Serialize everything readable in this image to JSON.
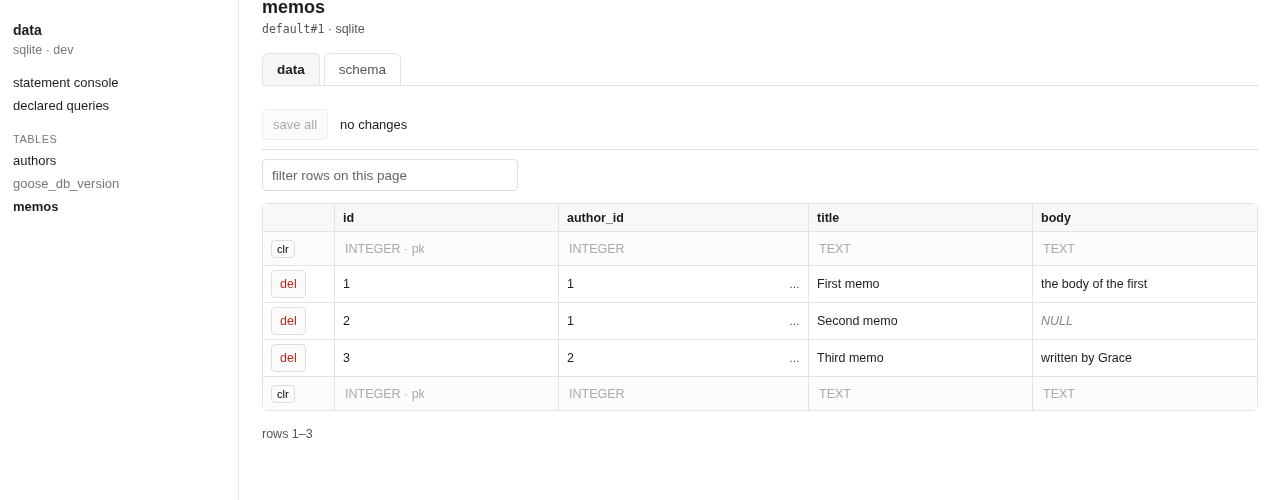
{
  "sidebar": {
    "title": "data",
    "subtitle": "sqlite · dev",
    "links": [
      {
        "label": "statement console"
      },
      {
        "label": "declared queries"
      }
    ],
    "section": "TABLES",
    "tables": [
      {
        "label": "authors",
        "selected": false,
        "dimmed": false
      },
      {
        "label": "goose_db_version",
        "selected": false,
        "dimmed": true
      },
      {
        "label": "memos",
        "selected": true,
        "dimmed": false
      }
    ]
  },
  "header": {
    "title": "memos",
    "connection": "default#1",
    "subtitle": " · sqlite"
  },
  "tabs": [
    {
      "label": "data",
      "selected": true
    },
    {
      "label": "schema",
      "selected": false
    }
  ],
  "toolbar": {
    "save_button": "save all",
    "save_disabled": true,
    "status": "no changes"
  },
  "filter": {
    "placeholder": "filter rows on this page"
  },
  "table": {
    "columns": [
      "id",
      "author_id",
      "title",
      "body"
    ],
    "top_filter": {
      "clear_button": "clr",
      "type_hints": [
        "INTEGER · pk",
        "INTEGER",
        "TEXT",
        "TEXT"
      ]
    },
    "rows": [
      {
        "delete_button": "del",
        "fk_button": "…",
        "cells": [
          {
            "value": "1",
            "null": false
          },
          {
            "value": "1",
            "null": false
          },
          {
            "value": "First memo",
            "null": false
          },
          {
            "value": "the body of the first",
            "null": false
          }
        ]
      },
      {
        "delete_button": "del",
        "fk_button": "…",
        "cells": [
          {
            "value": "2",
            "null": false
          },
          {
            "value": "1",
            "null": false
          },
          {
            "value": "Second memo",
            "null": false
          },
          {
            "value": "NULL",
            "null": true
          }
        ]
      },
      {
        "delete_button": "del",
        "fk_button": "…",
        "cells": [
          {
            "value": "3",
            "null": false
          },
          {
            "value": "2",
            "null": false
          },
          {
            "value": "Third memo",
            "null": false
          },
          {
            "value": "written by Grace",
            "null": false
          }
        ]
      }
    ],
    "bottom_filter": {
      "clear_button": "clr",
      "type_hints": [
        "INTEGER · pk",
        "INTEGER",
        "TEXT",
        "TEXT"
      ]
    }
  },
  "footer": "rows 1–3"
}
